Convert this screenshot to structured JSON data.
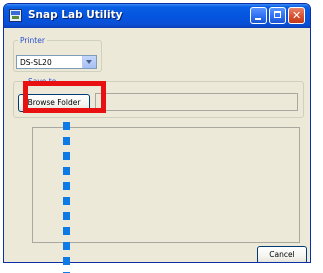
{
  "window": {
    "title": "Snap Lab Utility",
    "icon": "app-icon",
    "controls": [
      "minimize-icon",
      "maximize-icon",
      "close-icon"
    ]
  },
  "printer_group": {
    "label": "Printer",
    "selected": "DS-SL20"
  },
  "save_group": {
    "label": "Save to",
    "browse_label": "Browse Folder",
    "path_value": ""
  },
  "footer": {
    "cancel_label": "Cancel"
  },
  "colors": {
    "window_bg": "#ece9d8",
    "titlebar": "#0455e0",
    "highlight": "#e81010",
    "guide": "#0e7ae6"
  }
}
